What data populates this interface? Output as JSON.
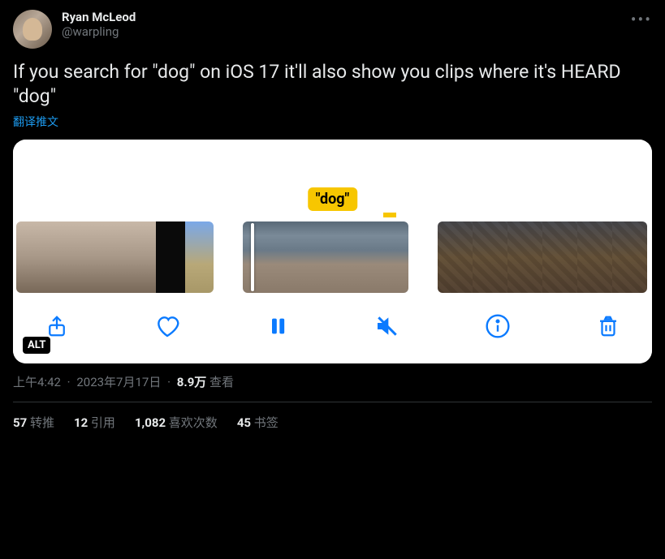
{
  "author": {
    "display_name": "Ryan McLeod",
    "handle": "@warpling"
  },
  "body": "If you search for \"dog\" on iOS 17 it'll also show you clips where it's HEARD \"dog\"",
  "translate_label": "翻译推文",
  "media": {
    "highlight_label": "\"dog\"",
    "alt_badge": "ALT"
  },
  "meta": {
    "time": "上午4:42",
    "date": "2023年7月17日",
    "views_count": "8.9万",
    "views_label": "查看"
  },
  "stats": {
    "retweets": {
      "count": "57",
      "label": "转推"
    },
    "quotes": {
      "count": "12",
      "label": "引用"
    },
    "likes": {
      "count": "1,082",
      "label": "喜欢次数"
    },
    "bookmarks": {
      "count": "45",
      "label": "书签"
    }
  }
}
